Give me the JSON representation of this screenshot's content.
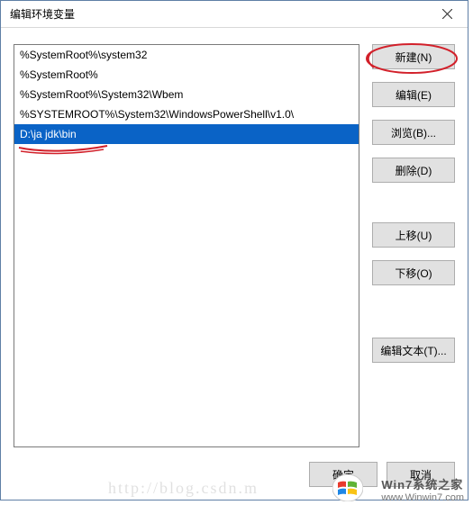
{
  "window": {
    "title": "编辑环境变量",
    "close_icon": "close-icon"
  },
  "path_list": {
    "items": [
      {
        "value": "%SystemRoot%\\system32",
        "selected": false
      },
      {
        "value": "%SystemRoot%",
        "selected": false
      },
      {
        "value": "%SystemRoot%\\System32\\Wbem",
        "selected": false
      },
      {
        "value": "%SYSTEMROOT%\\System32\\WindowsPowerShell\\v1.0\\",
        "selected": false
      },
      {
        "value": "D:\\ja jdk\\bin",
        "selected": true
      }
    ]
  },
  "buttons": {
    "new": "新建(N)",
    "edit": "编辑(E)",
    "browse": "浏览(B)...",
    "delete": "删除(D)",
    "move_up": "上移(U)",
    "move_down": "下移(O)",
    "edit_text": "编辑文本(T)...",
    "ok": "确定",
    "cancel": "取消"
  },
  "watermark": {
    "faded_url": "http://blog.csdn.m",
    "brand_cn": "Win7系统之家",
    "brand_en": "www.Winwin7.com"
  },
  "annotations": {
    "circle_new_button": true,
    "underline_selected_row": true
  },
  "colors": {
    "selection_bg": "#0a63c6",
    "button_bg": "#e1e1e1",
    "annotation": "#d2202a"
  }
}
